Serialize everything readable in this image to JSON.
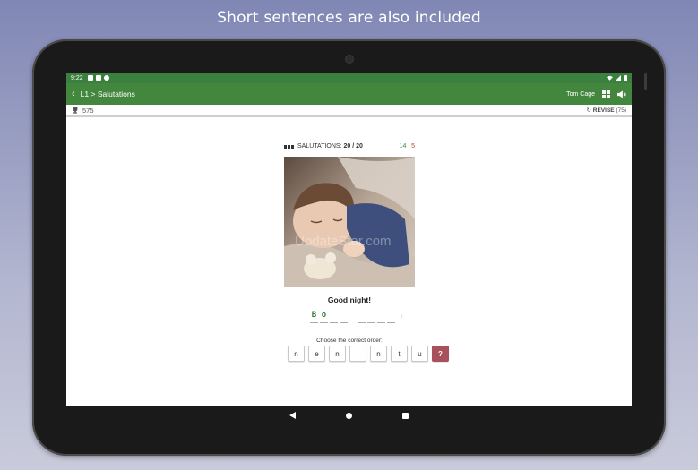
{
  "banner": {
    "text": "Short sentences are also included"
  },
  "status_bar": {
    "time": "9:22"
  },
  "app_bar": {
    "breadcrumb": "L1 > Salutations",
    "user_name": "Tom Cage"
  },
  "score_bar": {
    "score": "575",
    "revise_label": "REVISE",
    "revise_count": "(75)"
  },
  "lesson": {
    "title_prefix": "SALUTATIONS:",
    "title_progress": "20 / 20",
    "correct_count": "14",
    "separator": "|",
    "wrong_count": "5"
  },
  "exercise": {
    "phrase": "Good night!",
    "answer_letters": [
      "B",
      "o",
      "",
      "",
      "",
      "",
      "",
      "",
      ""
    ],
    "answer_punctuation": "!",
    "instruction": "Choose the correct order:",
    "tiles": [
      "n",
      "e",
      "n",
      "i",
      "n",
      "t",
      "u"
    ],
    "hint_label": "?"
  },
  "photo": {
    "watermark": "UpdateStar.com"
  },
  "colors": {
    "accent": "#43873f",
    "hint": "#a8505c"
  },
  "icons": {
    "back": "chevron-left-icon",
    "grid": "grid-icon",
    "speaker": "speaker-icon",
    "trophy": "trophy-icon",
    "revise": "refresh-icon"
  }
}
